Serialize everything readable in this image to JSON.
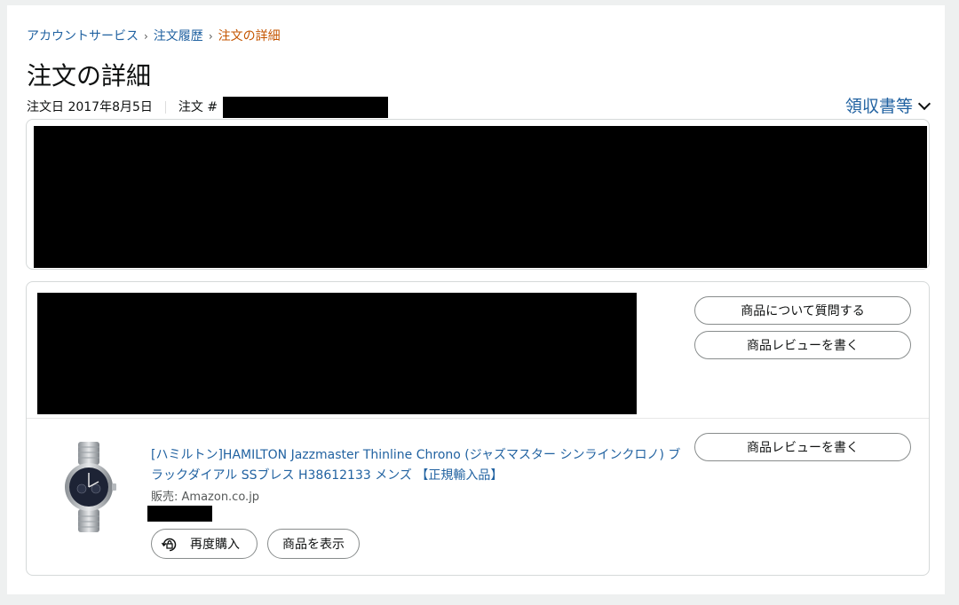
{
  "breadcrumb": {
    "account_service": "アカウントサービス",
    "order_history": "注文履歴",
    "current": "注文の詳細"
  },
  "page_title": "注文の詳細",
  "order": {
    "date_label": "注文日 2017年8月5日",
    "number_label": "注文 #"
  },
  "receipt_dropdown_label": "領収書等",
  "shipment": {
    "question_button": "商品について質問する",
    "review_button": "商品レビューを書く"
  },
  "item": {
    "title": "[ハミルトン]HAMILTON Jazzmaster Thinline Chrono (ジャズマスター シンラインクロノ) ブラックダイアル SSブレス H38612133 メンズ 【正規輸入品】",
    "seller": "販売: Amazon.co.jp",
    "rebuy_button": "再度購入",
    "view_button": "商品を表示",
    "review_button": "商品レビューを書く"
  },
  "colors": {
    "link": "#2162a1",
    "breadcrumb_current": "#c45500",
    "border": "#d5d9d9"
  },
  "icons": [
    "chevron-down-icon",
    "rebuy-icon",
    "watch-product-image"
  ]
}
